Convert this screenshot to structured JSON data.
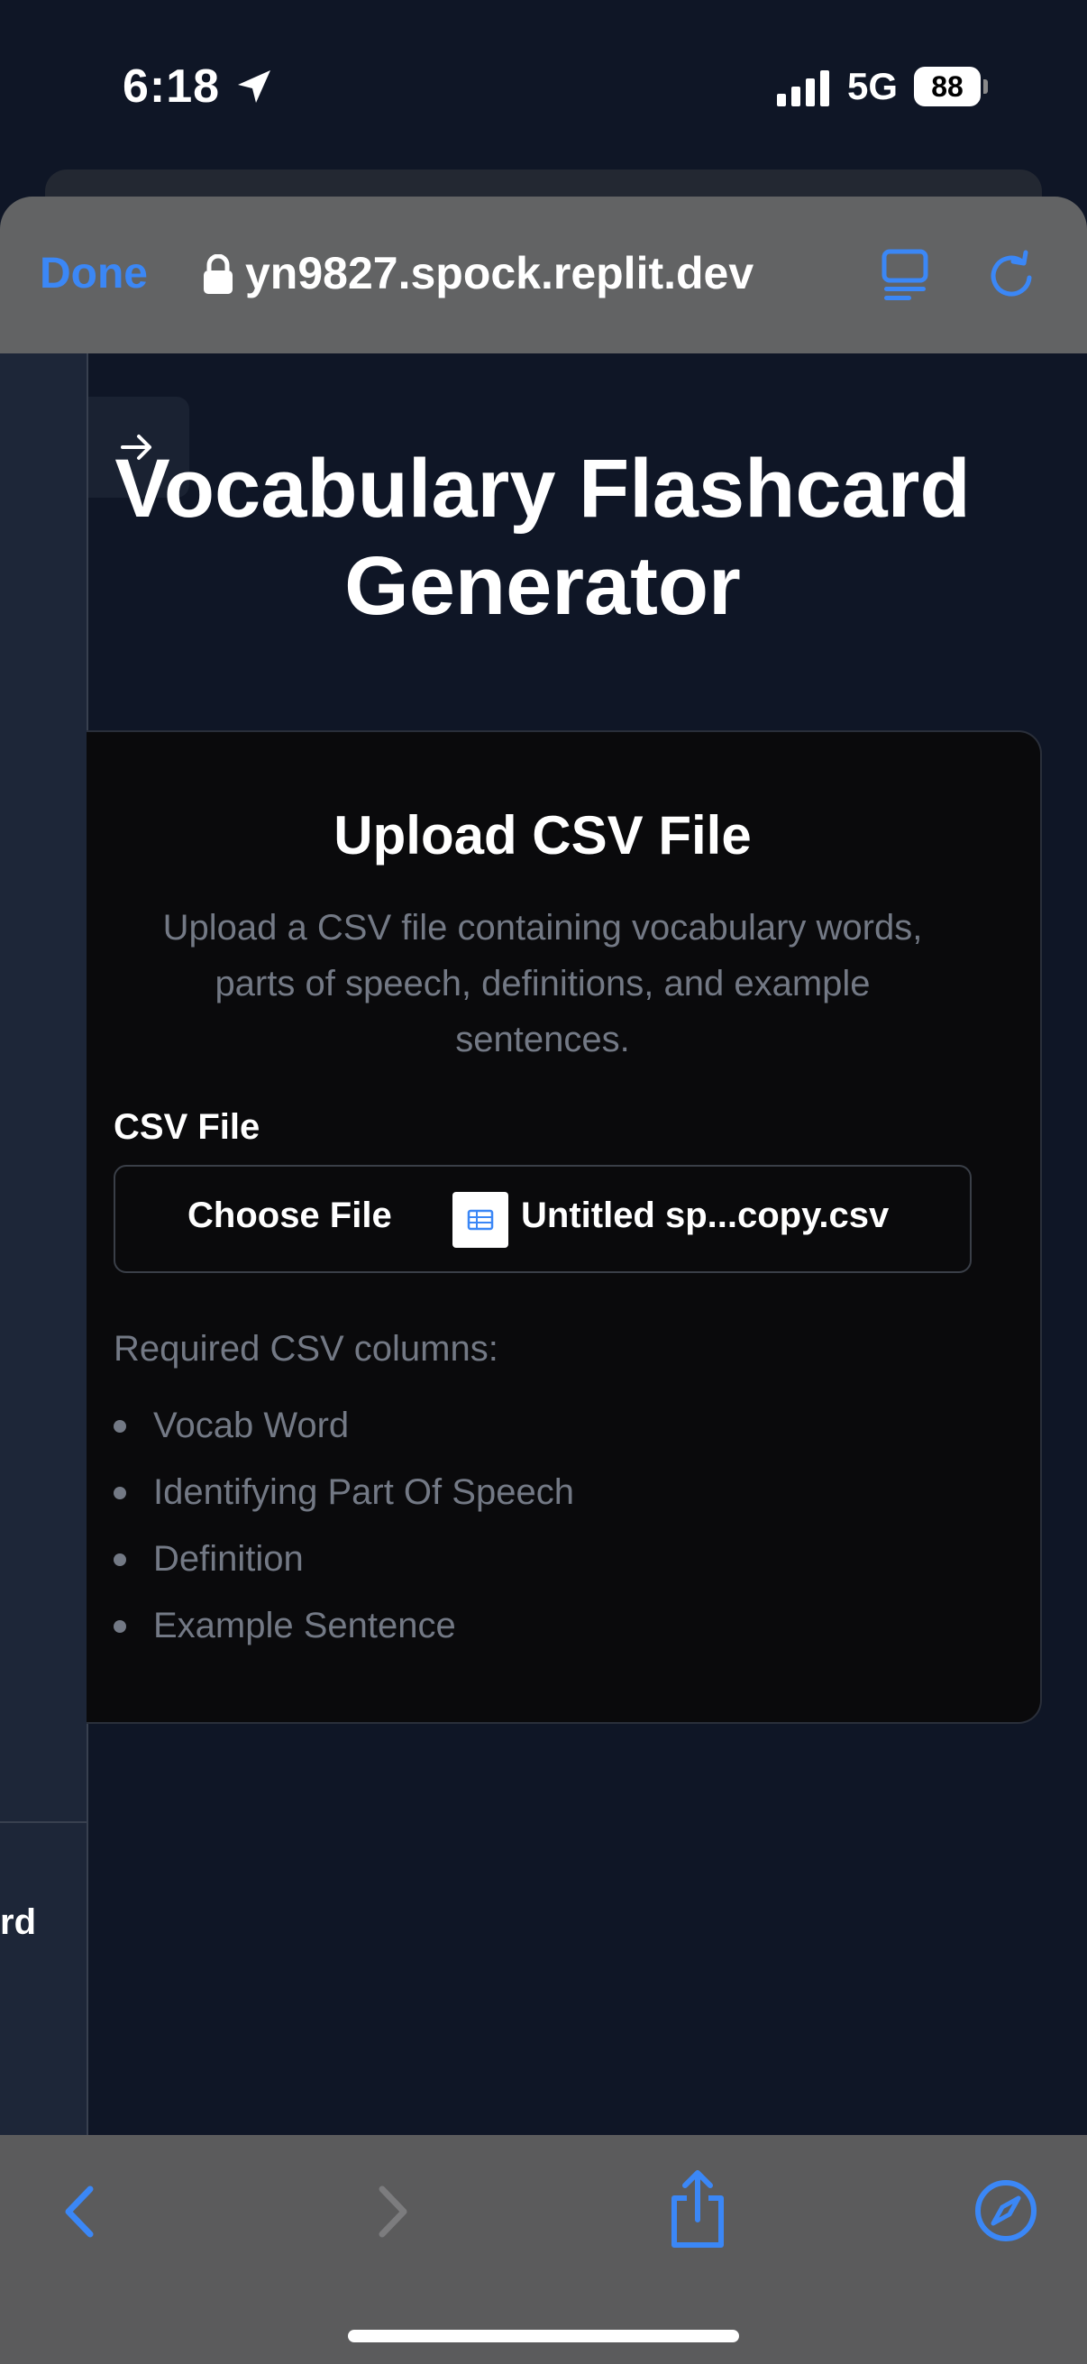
{
  "status_bar": {
    "time": "6:18",
    "network": "5G",
    "battery": "88"
  },
  "browser": {
    "done_label": "Done",
    "url": "yn9827.spock.replit.dev"
  },
  "sidebar": {
    "label": "rd"
  },
  "page": {
    "title": "Vocabulary Flashcard Generator"
  },
  "card": {
    "title": "Upload CSV File",
    "description": "Upload a CSV file containing vocabulary words, parts of speech, definitions, and example sentences.",
    "field_label": "CSV File",
    "choose_button": "Choose File",
    "file_name": "Untitled sp...copy.csv",
    "required_heading": "Required CSV columns:",
    "required_columns": [
      "Vocab Word",
      "Identifying Part Of Speech",
      "Definition",
      "Example Sentence"
    ]
  },
  "colors": {
    "accent": "#3b87f6",
    "background": "#0f1626",
    "card": "#0a0a0c",
    "muted_text": "#737985"
  }
}
